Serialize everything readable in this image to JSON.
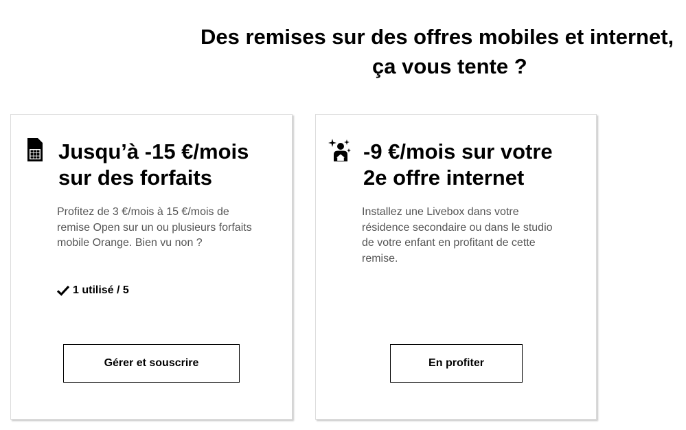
{
  "headline": {
    "line1": "Des remises sur des offres mobiles et internet,",
    "line2": "ça vous tente ?"
  },
  "offers": [
    {
      "icon": "sim-card-icon",
      "title_line1": "Jusqu’à -15 €/mois",
      "title_line2": "sur des forfaits",
      "description": "Profitez de 3 €/mois à 15 €/mois de remise Open sur un ou plusieurs forfaits mobile Orange. Bien vu non ?",
      "usage": "1 utilisé / 5",
      "cta_label": "Gérer et souscrire"
    },
    {
      "icon": "sparkle-person-home-icon",
      "title_line1": "-9 €/mois sur votre",
      "title_line2": "2e offre internet",
      "description": "Installez une Livebox dans votre résidence secondaire ou dans le studio de votre enfant en profitant de cette remise.",
      "cta_label": "En profiter"
    }
  ]
}
